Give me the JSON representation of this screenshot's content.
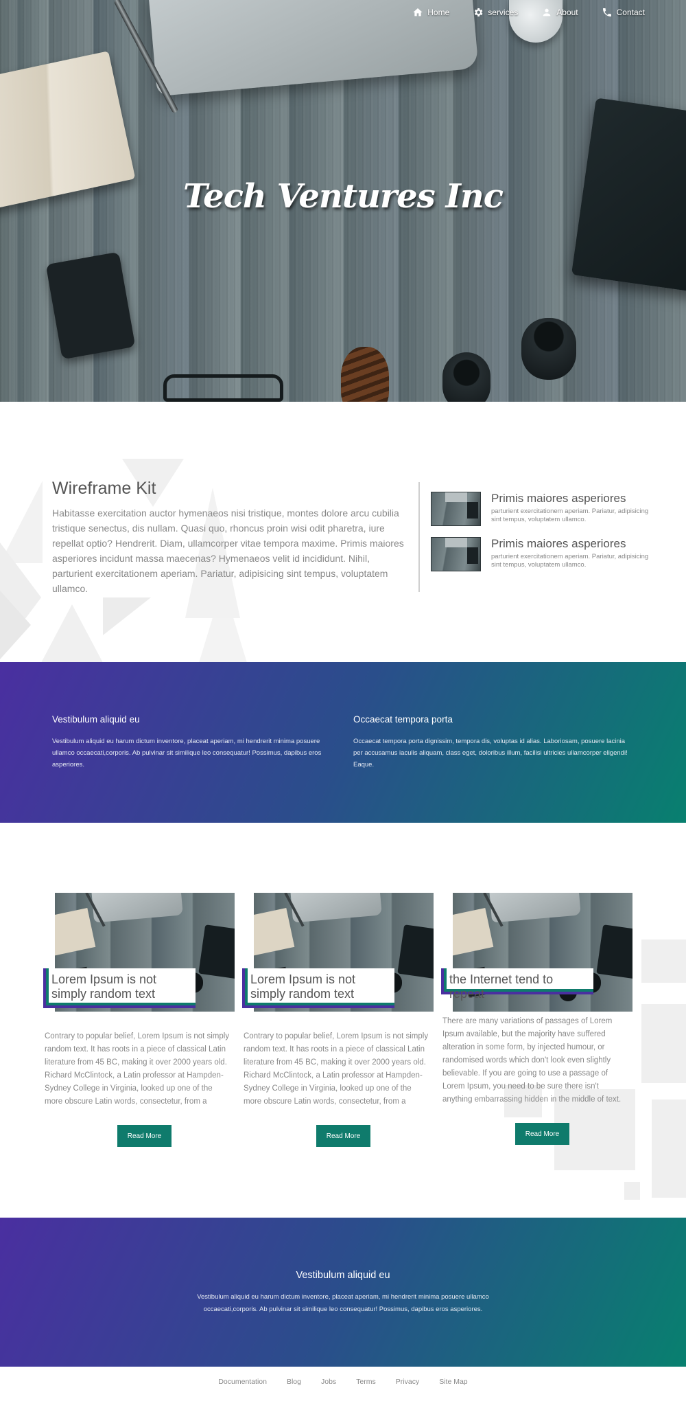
{
  "nav": {
    "items": [
      {
        "label": "Home",
        "icon": "home-icon"
      },
      {
        "label": "services",
        "icon": "gear-icon"
      },
      {
        "label": "About",
        "icon": "person-icon"
      },
      {
        "label": "Contact",
        "icon": "phone-icon"
      }
    ]
  },
  "hero": {
    "title": "Tech Ventures Inc"
  },
  "kit": {
    "title": "Wireframe Kit",
    "body": "Habitasse exercitation auctor hymenaeos nisi tristique, montes dolore arcu cubilia tristique senectus, dis nullam. Quasi quo, rhoncus proin wisi odit pharetra, iure repellat optio? Hendrerit. Diam, ullamcorper vitae tempora maxime. Primis maiores asperiores incidunt massa maecenas? Hymenaeos velit id incididunt. Nihil, parturient exercitationem aperiam. Pariatur, adipisicing sint tempus, voluptatem ullamco.",
    "items": [
      {
        "title": "Primis maiores asperiores",
        "text": "parturient exercitationem aperiam. Pariatur, adipisicing sint tempus, voluptatem ullamco."
      },
      {
        "title": "Primis maiores asperiores",
        "text": "parturient exercitationem aperiam. Pariatur, adipisicing sint tempus, voluptatem ullamco."
      }
    ]
  },
  "band1": {
    "left": {
      "title": "Vestibulum aliquid eu",
      "text": "Vestibulum aliquid eu harum dictum inventore, placeat aperiam, mi hendrerit minima posuere ullamco occaecati,corporis. Ab pulvinar sit similique leo consequatur! Possimus, dapibus eros asperiores."
    },
    "right": {
      "title": "Occaecat tempora porta",
      "text": "Occaecat tempora porta dignissim, tempora dis, voluptas id alias. Laboriosam, posuere lacinia per accusamus iaculis aliquam, class eget, doloribus illum, facilisi ultricies ullamcorper eligendi! Eaque."
    }
  },
  "cards": [
    {
      "tag_line1": "Lorem Ipsum is not",
      "tag_line2": "simply random text",
      "text": "Contrary to popular belief, Lorem Ipsum is not simply random text. It has roots in a piece of classical Latin literature from 45 BC, making it over 2000 years old. Richard McClintock, a Latin professor at Hampden-Sydney College in Virginia, looked up one of the more obscure Latin words, consectetur, from a",
      "button": "Read More"
    },
    {
      "tag_line1": "Lorem Ipsum is not",
      "tag_line2": "simply random text",
      "text": "Contrary to popular belief, Lorem Ipsum is not simply random text. It has roots in a piece of classical Latin literature from 45 BC, making it over 2000 years old. Richard McClintock, a Latin professor at Hampden-Sydney College in Virginia, looked up one of the more obscure Latin words, consectetur, from a",
      "button": "Read More"
    },
    {
      "tag_line1": "the Internet tend to repeat",
      "text": "There are many variations of passages of Lorem Ipsum available, but the majority have suffered alteration in some form, by injected humour, or randomised words which don't look even slightly believable. If you are going to use a passage of Lorem Ipsum, you need to be sure there isn't anything embarrassing hidden in the middle of text.",
      "button": "Read More"
    }
  ],
  "band2": {
    "title": "Vestibulum aliquid eu",
    "text": "Vestibulum aliquid eu harum dictum inventore, placeat aperiam, mi hendrerit minima posuere ullamco occaecati,corporis. Ab pulvinar sit similique leo consequatur! Possimus, dapibus eros asperiores."
  },
  "footer": {
    "links": [
      "Documentation",
      "Blog",
      "Jobs",
      "Terms",
      "Privacy",
      "Site Map"
    ]
  },
  "colors": {
    "gradient_start": "#4a2fa0",
    "gradient_end": "#08806f",
    "button": "#0f7b6c",
    "accent_purple": "#4a2fa0"
  }
}
